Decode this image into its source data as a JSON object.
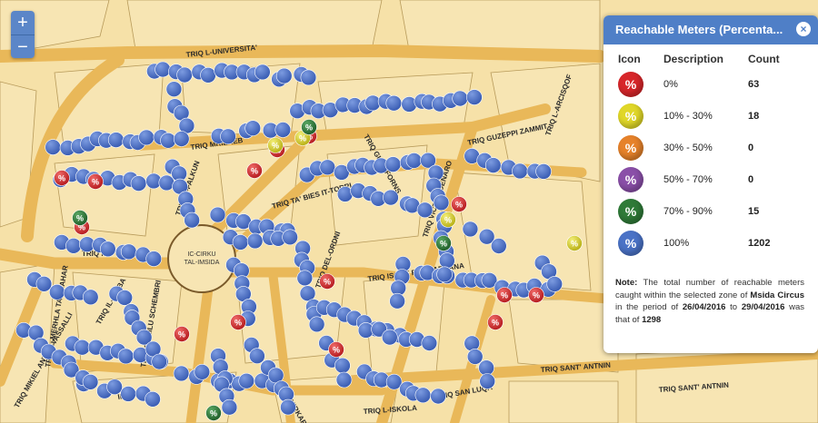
{
  "map": {
    "streets": [
      "TRIQ L-UNIVERSITA'",
      "TRIQ MRIEREB",
      "TRIQ GUZE FORNS",
      "TRIQ TA' BIES IT-TORRI",
      "TRIQ GUZEPPI ZAMMIT",
      "TRIQ VICTOR DENARO",
      "TRIQ IL-FALKUN",
      "TRIQ IL-PUNENT",
      "TRIQ IL-MEDDAWAR",
      "TRIQ DEL-ORDNI",
      "TRIQ ISQOF F. S. CARUANA",
      "TRIQ L-ISQOF F. S. CARUANA",
      "TRIQ SANT' ANTNIN",
      "TRIQ L-ISKOLA",
      "TRIQ SAN LUQA",
      "TRIQ SANT' ANTNIN",
      "TRIQ MIKIEL ANTON VASSALLI",
      "TRIQ CAMILU SCHEMBRI",
      "TRIQ BIRKIRKARA",
      "TRIQ IL-MIRBA",
      "TRIQ IL-MERHLA TAL-BAHAR",
      "ID-DEJQA",
      "TRIQ L-ARCISQOF"
    ],
    "roundabout_label": "IC-CIRKU TAL-IMSIDA",
    "marker_colors": {
      "red": "#d7262a",
      "yellow": "#e0d728",
      "orange": "#e6822a",
      "purple": "#8a4fa8",
      "green": "#2f7a38",
      "blue": "#4a72c6"
    }
  },
  "zoom": {
    "in_label": "+",
    "out_label": "−"
  },
  "legend": {
    "title": "Reachable Meters (Percenta...",
    "close_label": "×",
    "col_icon": "Icon",
    "col_description": "Description",
    "col_count": "Count",
    "rows": [
      {
        "glyph": "%",
        "color": "#d7262a",
        "description": "0%",
        "count": "63"
      },
      {
        "glyph": "%",
        "color": "#e0d728",
        "description": "10% - 30%",
        "count": "18"
      },
      {
        "glyph": "%",
        "color": "#e6822a",
        "description": "30% - 50%",
        "count": "0"
      },
      {
        "glyph": "%",
        "color": "#8a4fa8",
        "description": "50% - 70%",
        "count": "0"
      },
      {
        "glyph": "%",
        "color": "#2f7a38",
        "description": "70% - 90%",
        "count": "15"
      },
      {
        "glyph": "%",
        "color": "#4a72c6",
        "description": "100%",
        "count": "1202"
      }
    ],
    "note": {
      "label": "Note:",
      "text1": " The total number of reachable meters caught within the selected zone of ",
      "zone": "Msida Circus",
      "text2": " in the period of ",
      "date_from": "26/04/2016",
      "text3": " to ",
      "date_to": "29/04/2016",
      "text4": " was that of ",
      "total": "1298"
    }
  }
}
